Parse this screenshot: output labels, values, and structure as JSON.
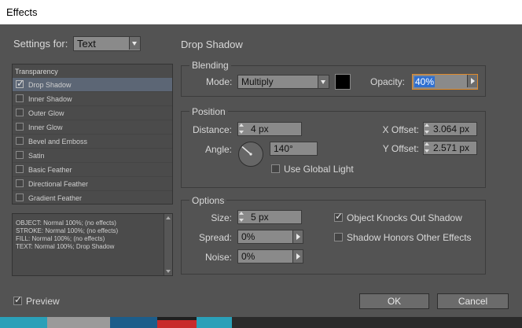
{
  "window": {
    "title": "Effects"
  },
  "settings_for": {
    "label": "Settings for:",
    "value": "Text"
  },
  "section_title": "Drop Shadow",
  "effects_list": {
    "header": "Transparency",
    "items": [
      {
        "label": "Drop Shadow",
        "checked": true,
        "selected": true
      },
      {
        "label": "Inner Shadow",
        "checked": false
      },
      {
        "label": "Outer Glow",
        "checked": false
      },
      {
        "label": "Inner Glow",
        "checked": false
      },
      {
        "label": "Bevel and Emboss",
        "checked": false
      },
      {
        "label": "Satin",
        "checked": false
      },
      {
        "label": "Basic Feather",
        "checked": false
      },
      {
        "label": "Directional Feather",
        "checked": false
      },
      {
        "label": "Gradient Feather",
        "checked": false
      }
    ]
  },
  "summary": [
    "OBJECT: Normal 100%; (no effects)",
    "STROKE: Normal 100%; (no effects)",
    "FILL: Normal 100%; (no effects)",
    "TEXT: Normal 100%; Drop Shadow"
  ],
  "blending": {
    "title": "Blending",
    "mode_label": "Mode:",
    "mode_value": "Multiply",
    "color": "#000000",
    "opacity_label": "Opacity:",
    "opacity_value": "40%"
  },
  "position": {
    "title": "Position",
    "distance_label": "Distance:",
    "distance_value": "4 px",
    "angle_label": "Angle:",
    "angle_value": "140°",
    "global_light_label": "Use Global Light",
    "global_light_checked": false,
    "x_offset_label": "X Offset:",
    "x_offset_value": "3.064 px",
    "y_offset_label": "Y Offset:",
    "y_offset_value": "2.571 px"
  },
  "options": {
    "title": "Options",
    "size_label": "Size:",
    "size_value": "5 px",
    "spread_label": "Spread:",
    "spread_value": "0%",
    "noise_label": "Noise:",
    "noise_value": "0%",
    "knocks_out_label": "Object Knocks Out Shadow",
    "knocks_out_checked": true,
    "honors_label": "Shadow Honors Other Effects",
    "honors_checked": false
  },
  "preview": {
    "label": "Preview",
    "checked": true
  },
  "buttons": {
    "ok": "OK",
    "cancel": "Cancel"
  },
  "colors": {
    "background": "#535353",
    "highlight": "#2f6fd1",
    "focus_border": "#e08a2a"
  }
}
